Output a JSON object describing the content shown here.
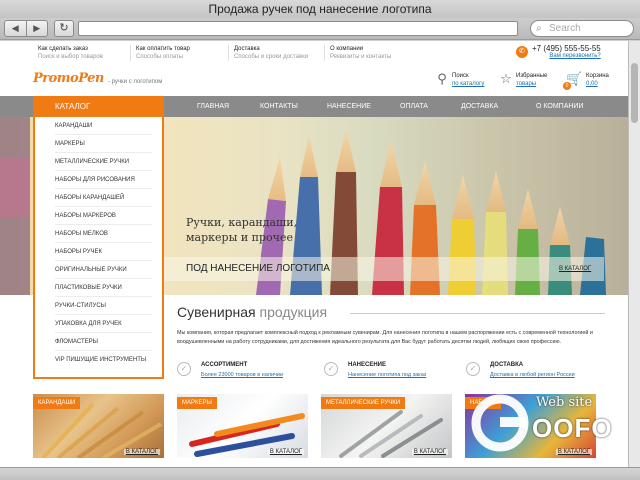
{
  "window": {
    "title": "Продажа ручек под нанесение логотипа"
  },
  "browser": {
    "search_placeholder": "Search"
  },
  "topinfo": [
    {
      "title": "Как сделать заказ",
      "sub": "Поиск и выбор товаров"
    },
    {
      "title": "Как оплатить товар",
      "sub": "Способы оплаты"
    },
    {
      "title": "Доставка",
      "sub": "Способы и сроки доставки"
    },
    {
      "title": "О компании",
      "sub": "Реквизиты и контакты"
    }
  ],
  "phone": {
    "number": "+7 (495) 555-55-55",
    "callback": "Вам перезвонить?"
  },
  "logo": {
    "part1": "Promo",
    "part2": "Pen"
  },
  "tagline": "- ручки с логотипом",
  "tools": {
    "search": {
      "label": "Поиск",
      "link": "по каталогу"
    },
    "favorites": {
      "label": "Избранные",
      "link": "товары"
    },
    "cart": {
      "label": "Корзина",
      "link": "0,00",
      "count": "0"
    }
  },
  "menu": {
    "catalog": "КАТАЛОГ",
    "items": [
      "ГЛАВНАЯ",
      "КОНТАКТЫ",
      "НАНЕСЕНИЕ",
      "ОПЛАТА",
      "ДОСТАВКА",
      "О КОМПАНИИ"
    ]
  },
  "catalog_items": [
    "КАРАНДАШИ",
    "МАРКЕРЫ",
    "МЕТАЛЛИЧЕСКИЕ РУЧКИ",
    "НАБОРЫ ДЛЯ РИСОВАНИЯ",
    "НАБОРЫ КАРАНДАШЕЙ",
    "НАБОРЫ МАРКЕРОВ",
    "НАБОРЫ МЕЛКОВ",
    "НАБОРЫ РУЧЕК",
    "ОРИГИНАЛЬНЫЕ РУЧКИ",
    "ПЛАСТИКОВЫЕ РУЧКИ",
    "РУЧКИ-СТИЛУСЫ",
    "УПАКОВКА ДЛЯ РУЧЕК",
    "ФЛОМАСТЕРЫ",
    "VIP ПИШУЩИЕ ИНСТРУМЕНТЫ"
  ],
  "hero": {
    "line1": "Ручки, карандаши,",
    "line2": "маркеры и прочее",
    "sub": "ПОД НАНЕСЕНИЕ ЛОГОТИПА",
    "link": "В КАТАЛОГ"
  },
  "section": {
    "title1": "Сувенирная",
    "title2": " продукция",
    "text": "Мы компания, которая предлагает комплексный подход к рекламным сувенирам. Для нанесения логотипа в нашем распоряжении есть с современной технологией и воодушевленными на работу сотрудниками, для достижения идеального результата для Вас будут работать десятки людей, любящих свою профессию."
  },
  "features": [
    {
      "title": "АССОРТИМЕНТ",
      "link": "Более 23000 товаров в наличии"
    },
    {
      "title": "НАНЕСЕНИЕ",
      "link": "Нанесение логотипа под заказ"
    },
    {
      "title": "ДОСТАВКА",
      "link": "Доставка в любой регион России"
    }
  ],
  "cards": [
    {
      "label": "КАРАНДАШИ",
      "link": "В КАТАЛОГ"
    },
    {
      "label": "МАРКЕРЫ",
      "link": "В КАТАЛОГ"
    },
    {
      "label": "МЕТАЛЛИЧЕСКИЕ РУЧКИ",
      "link": "В КАТАЛОГ"
    },
    {
      "label": "НАБОРЫ",
      "link": "В КАТАЛОГ"
    }
  ],
  "watermark": {
    "line1": "Web site",
    "line2": "OOFO"
  },
  "colors": {
    "accent": "#f07b13",
    "menu": "#8a8a8a",
    "link": "#1e6fb8"
  }
}
